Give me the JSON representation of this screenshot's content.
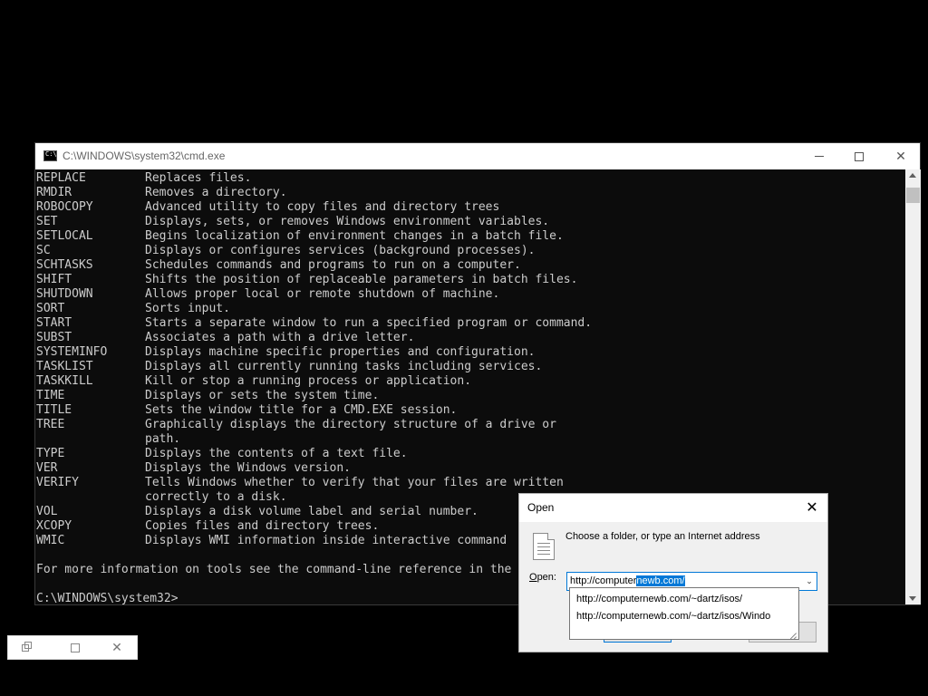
{
  "cmd": {
    "title": "C:\\WINDOWS\\system32\\cmd.exe",
    "commands": [
      {
        "name": "REPLACE",
        "desc": "Replaces files."
      },
      {
        "name": "RMDIR",
        "desc": "Removes a directory."
      },
      {
        "name": "ROBOCOPY",
        "desc": "Advanced utility to copy files and directory trees"
      },
      {
        "name": "SET",
        "desc": "Displays, sets, or removes Windows environment variables."
      },
      {
        "name": "SETLOCAL",
        "desc": "Begins localization of environment changes in a batch file."
      },
      {
        "name": "SC",
        "desc": "Displays or configures services (background processes)."
      },
      {
        "name": "SCHTASKS",
        "desc": "Schedules commands and programs to run on a computer."
      },
      {
        "name": "SHIFT",
        "desc": "Shifts the position of replaceable parameters in batch files."
      },
      {
        "name": "SHUTDOWN",
        "desc": "Allows proper local or remote shutdown of machine."
      },
      {
        "name": "SORT",
        "desc": "Sorts input."
      },
      {
        "name": "START",
        "desc": "Starts a separate window to run a specified program or command."
      },
      {
        "name": "SUBST",
        "desc": "Associates a path with a drive letter."
      },
      {
        "name": "SYSTEMINFO",
        "desc": "Displays machine specific properties and configuration."
      },
      {
        "name": "TASKLIST",
        "desc": "Displays all currently running tasks including services."
      },
      {
        "name": "TASKKILL",
        "desc": "Kill or stop a running process or application."
      },
      {
        "name": "TIME",
        "desc": "Displays or sets the system time."
      },
      {
        "name": "TITLE",
        "desc": "Sets the window title for a CMD.EXE session."
      },
      {
        "name": "TREE",
        "desc": "Graphically displays the directory structure of a drive or"
      },
      {
        "name": "",
        "desc": "path."
      },
      {
        "name": "TYPE",
        "desc": "Displays the contents of a text file."
      },
      {
        "name": "VER",
        "desc": "Displays the Windows version."
      },
      {
        "name": "VERIFY",
        "desc": "Tells Windows whether to verify that your files are written"
      },
      {
        "name": "",
        "desc": "correctly to a disk."
      },
      {
        "name": "VOL",
        "desc": "Displays a disk volume label and serial number."
      },
      {
        "name": "XCOPY",
        "desc": "Copies files and directory trees."
      },
      {
        "name": "WMIC",
        "desc": "Displays WMI information inside interactive command"
      }
    ],
    "footer": "For more information on tools see the command-line reference in the",
    "prompt": "C:\\WINDOWS\\system32>"
  },
  "dialog": {
    "title": "Open",
    "prompt_text": "Choose a folder, or type an Internet address",
    "open_label": "pen:",
    "open_label_accel": "O",
    "input_value_plain": "http://computer",
    "input_value_selected": "newb.com/",
    "dropdown_items": [
      "http://computernewb.com/~dartz/isos/",
      "http://computernewb.com/~dartz/isos/Windo"
    ]
  },
  "icons": {
    "cmd": "cmd-icon",
    "minimize": "minimize-icon",
    "maximize": "maximize-icon",
    "close": "close-icon",
    "document": "document-icon",
    "dropdown": "chevron-down-icon"
  }
}
